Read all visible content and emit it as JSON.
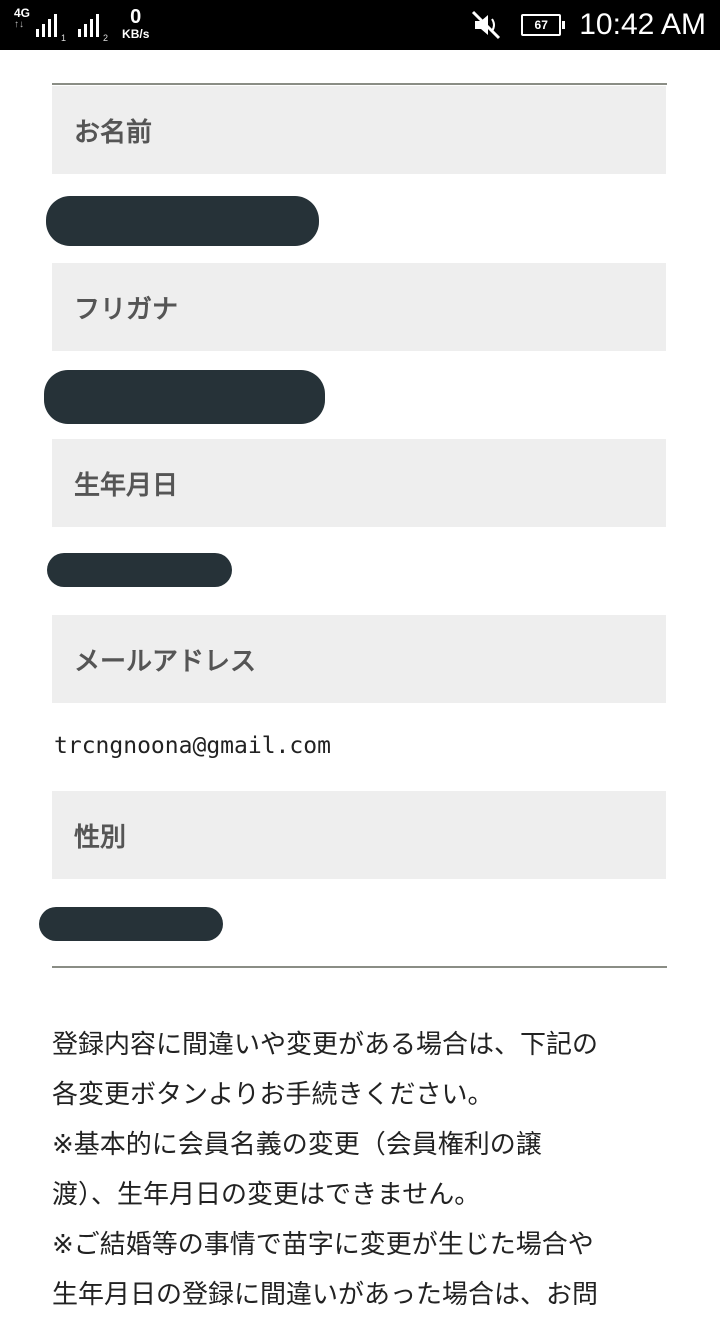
{
  "status_bar": {
    "network_type": "4G",
    "network_arrows": "↑↓",
    "sim1": "1",
    "sim2": "2",
    "data_speed_value": "0",
    "data_speed_unit": "KB/s",
    "battery_level": "67",
    "time": "10:42 AM"
  },
  "profile": {
    "fields": [
      {
        "label": "お名前",
        "value_redacted": true
      },
      {
        "label": "フリガナ",
        "value_redacted": true
      },
      {
        "label": "生年月日",
        "value_redacted": true
      },
      {
        "label": "メールアドレス",
        "value": "trcngnoona@gmail.com"
      },
      {
        "label": "性別",
        "value_redacted": true
      }
    ]
  },
  "notice": {
    "lines": [
      "登録内容に間違いや変更がある場合は、下記の",
      "各変更ボタンよりお手続きください。",
      "※基本的に会員名義の変更（会員権利の譲",
      "渡）、生年月日の変更はできません。",
      "※ご結婚等の事情で苗字に変更が生じた場合や",
      "生年月日の登録に間違いがあった場合は、お問"
    ]
  },
  "colors": {
    "header_bg": "#eeeeee",
    "label_text": "#555555",
    "redaction": "#263238",
    "divider": "#8a8d85"
  }
}
